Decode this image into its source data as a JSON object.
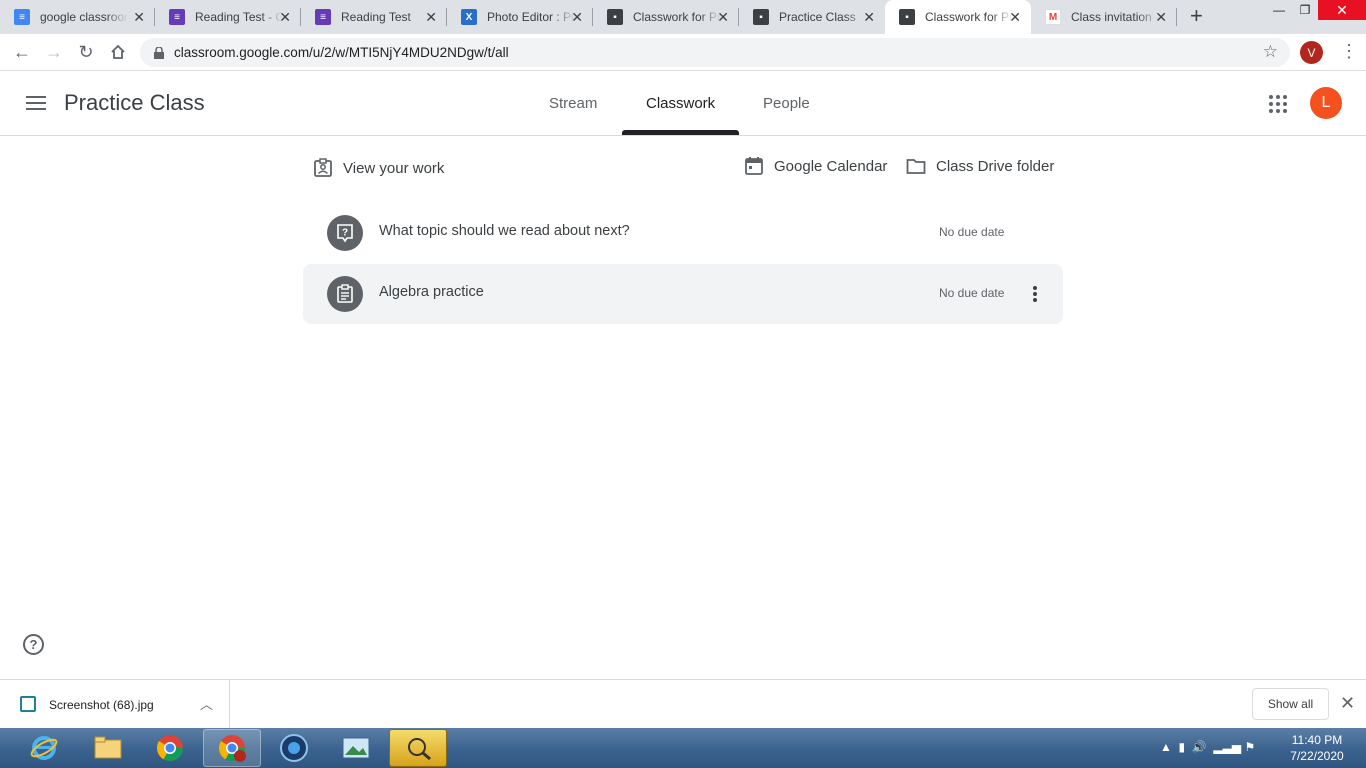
{
  "browser": {
    "tabs": [
      {
        "title": "google classroom",
        "icon": "docs-icon",
        "color": "#4285f4"
      },
      {
        "title": "Reading Test - Google Forms",
        "icon": "forms-icon",
        "color": "#673ab7"
      },
      {
        "title": "Reading Test",
        "icon": "forms-icon",
        "color": "#673ab7"
      },
      {
        "title": "Photo Editor : Pixlr",
        "icon": "pixlr-icon",
        "color": "#2a6ecc"
      },
      {
        "title": "Classwork for Practice Class",
        "icon": "classroom-icon",
        "color": "#3c4043"
      },
      {
        "title": "Practice Class",
        "icon": "classroom-icon",
        "color": "#3c4043"
      },
      {
        "title": "Classwork for Practice Class",
        "icon": "classroom-icon",
        "color": "#3c4043",
        "active": true
      },
      {
        "title": "Class invitation",
        "icon": "gmail-icon",
        "color": "#ea4335"
      }
    ],
    "url": "classroom.google.com/u/2/w/MTI5NjY4MDU2NDgw/t/all",
    "profile_initial": "V"
  },
  "header": {
    "class_name": "Practice Class",
    "tabs": [
      "Stream",
      "Classwork",
      "People"
    ],
    "active_tab": "Classwork",
    "user_initial": "L"
  },
  "actions": {
    "view_work": "View your work",
    "calendar": "Google Calendar",
    "drive": "Class Drive folder"
  },
  "classwork": [
    {
      "title": "What topic should we read about next?",
      "due": "No due date",
      "type": "question"
    },
    {
      "title": "Algebra practice",
      "due": "No due date",
      "type": "assignment"
    }
  ],
  "downloads": {
    "file_name": "Screenshot (68).jpg",
    "show_all": "Show all"
  },
  "taskbar": {
    "time": "11:40 PM",
    "date": "7/22/2020"
  },
  "colors": {
    "accent": "#202124",
    "user_avatar": "#f4511e",
    "profile_avatar": "#b3261e"
  }
}
